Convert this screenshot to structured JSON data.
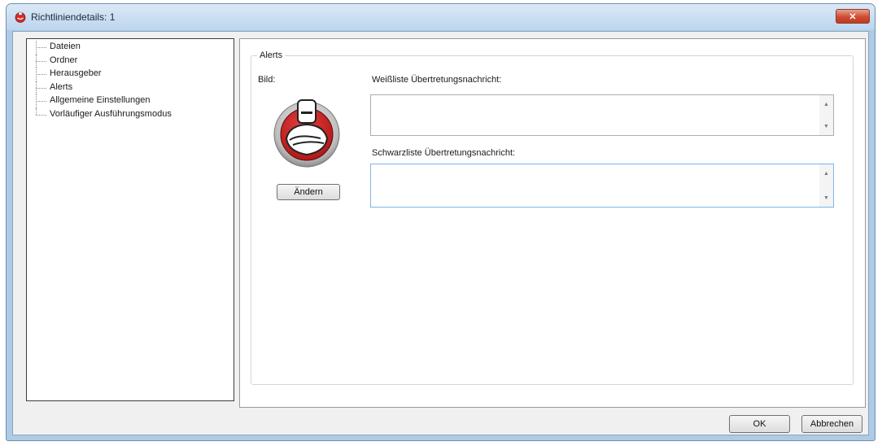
{
  "window": {
    "title": "Richtliniendetails: 1",
    "close_symbol": "✕"
  },
  "tree": {
    "items": [
      {
        "label": "Dateien"
      },
      {
        "label": "Ordner"
      },
      {
        "label": "Herausgeber"
      },
      {
        "label": "Alerts"
      },
      {
        "label": "Allgemeine Einstellungen"
      },
      {
        "label": "Vorläufiger Ausführungsmodus"
      }
    ]
  },
  "alerts_group": {
    "legend": "Alerts",
    "image_label": "Bild:",
    "change_button": "Ändern",
    "whitelist_label": "Weißliste Übertretungsnachricht:",
    "whitelist_value": "",
    "blacklist_label": "Schwarzliste Übertretungsnachricht:",
    "blacklist_value": ""
  },
  "buttons": {
    "ok": "OK",
    "cancel": "Abbrechen"
  },
  "icons": {
    "title": "app-mascot-icon",
    "avatar": "mascot-avatar-icon"
  },
  "colors": {
    "accent_red": "#d42a2a",
    "title_bar": "#c6dcf0",
    "close_button": "#cf4b32"
  }
}
